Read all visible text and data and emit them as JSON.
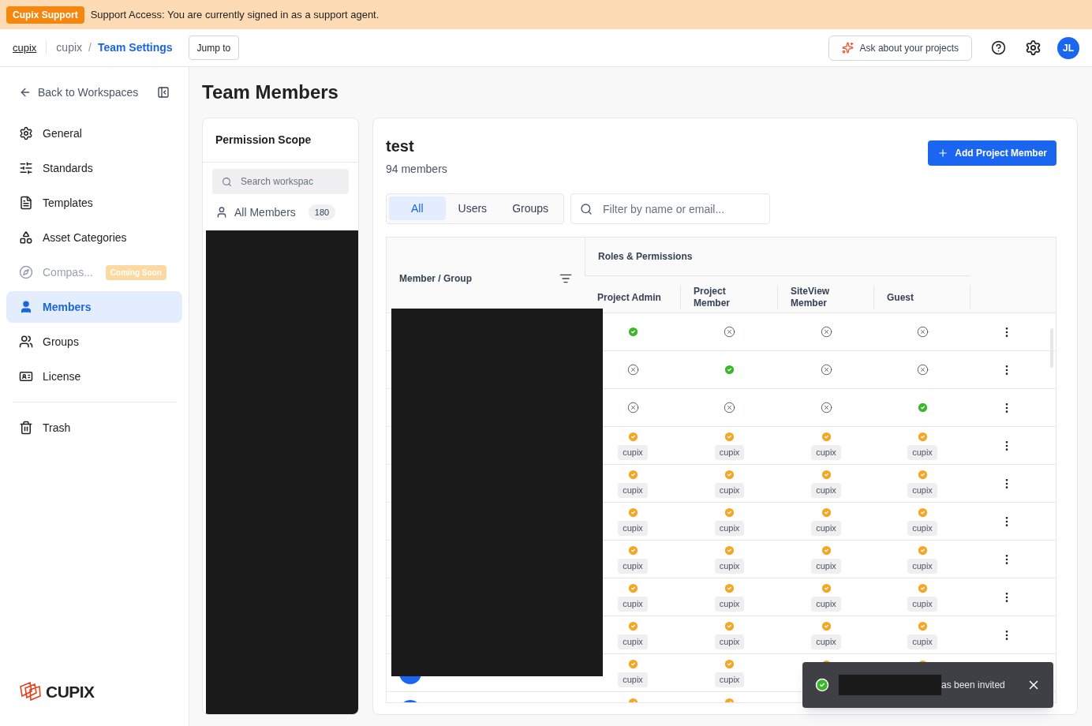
{
  "banner": {
    "badge": "Cupix Support",
    "message": "Support Access: You are currently signed in as a support agent."
  },
  "header": {
    "brand": "cupix",
    "breadcrumb": [
      "cupix",
      "Team Settings"
    ],
    "separator": "/",
    "jump_button": "Jump to",
    "ask_button": "Ask about your projects",
    "avatar": "JL"
  },
  "sidebar": {
    "back": "Back to Workspaces",
    "items": [
      {
        "label": "General",
        "selected": false,
        "disabled": false
      },
      {
        "label": "Standards",
        "selected": false,
        "disabled": false
      },
      {
        "label": "Templates",
        "selected": false,
        "disabled": false
      },
      {
        "label": "Asset Categories",
        "selected": false,
        "disabled": false
      },
      {
        "label": "Compas...",
        "selected": false,
        "disabled": true,
        "badge": "Coming Soon"
      },
      {
        "label": "Members",
        "selected": true,
        "disabled": false
      },
      {
        "label": "Groups",
        "selected": false,
        "disabled": false
      },
      {
        "label": "License",
        "selected": false,
        "disabled": false
      }
    ],
    "footer_items": [
      {
        "label": "Trash",
        "selected": false,
        "disabled": false
      }
    ],
    "logo": "CUPIX"
  },
  "page_title": "Team Members",
  "scope": {
    "title": "Permission Scope",
    "search": {
      "placeholder": "Search workspac"
    },
    "items": [
      {
        "label": "All Members",
        "count": "180",
        "selected": false
      }
    ]
  },
  "panel": {
    "title": "test",
    "subtitle": "94 members",
    "add_button": "Add Project Member",
    "tabs": [
      {
        "label": "All",
        "selected": true
      },
      {
        "label": "Users",
        "selected": false
      },
      {
        "label": "Groups",
        "selected": false
      }
    ],
    "filter": {
      "placeholder": "Filter by name or email..."
    },
    "table": {
      "member_column": "Member / Group",
      "group_heading": "Roles & Permissions",
      "role_columns": [
        "Project Admin",
        "Project Member",
        "SiteView Member",
        "Guest"
      ],
      "rows": [
        {
          "kind": "direct",
          "roles": [
            true,
            false,
            false,
            false
          ]
        },
        {
          "kind": "direct",
          "roles": [
            false,
            true,
            false,
            false
          ]
        },
        {
          "kind": "direct",
          "roles": [
            false,
            false,
            false,
            true
          ]
        },
        {
          "kind": "group",
          "tags": [
            "cupix",
            "cupix",
            "cupix",
            "cupix"
          ]
        },
        {
          "kind": "group",
          "tags": [
            "cupix",
            "cupix",
            "cupix",
            "cupix"
          ]
        },
        {
          "kind": "group",
          "tags": [
            "cupix",
            "cupix",
            "cupix",
            "cupix"
          ]
        },
        {
          "kind": "group",
          "tags": [
            "cupix",
            "cupix",
            "cupix",
            "cupix"
          ]
        },
        {
          "kind": "group",
          "tags": [
            "cupix",
            "cupix",
            "cupix",
            "cupix"
          ]
        },
        {
          "kind": "group",
          "tags": [
            "cupix",
            "cupix",
            "cupix",
            "cupix"
          ]
        },
        {
          "kind": "group",
          "tags": [
            "cupix",
            "cupix"
          ],
          "avatar_shown": true
        },
        {
          "kind": "group_cut",
          "checks": [
            true,
            true
          ],
          "avatar_shown": true
        }
      ]
    }
  },
  "toast": {
    "message": "as been invited"
  }
}
